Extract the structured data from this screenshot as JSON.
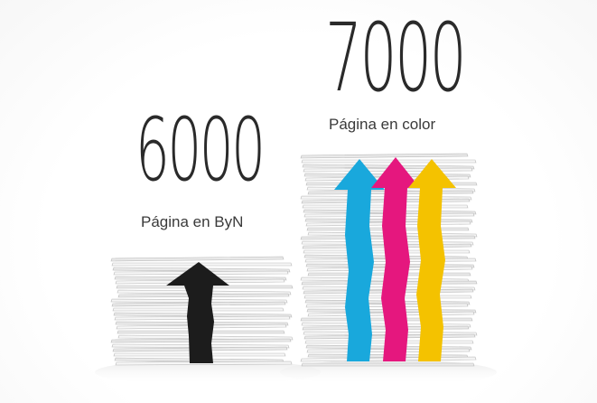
{
  "bw": {
    "number": "6000",
    "caption": "Página en ByN",
    "arrow_color": "#1c1c1c"
  },
  "color": {
    "number": "7000",
    "caption": "Página en color",
    "arrow_colors": {
      "cyan": "#19a8dc",
      "magenta": "#e5177e",
      "yellow": "#f4c200"
    }
  }
}
